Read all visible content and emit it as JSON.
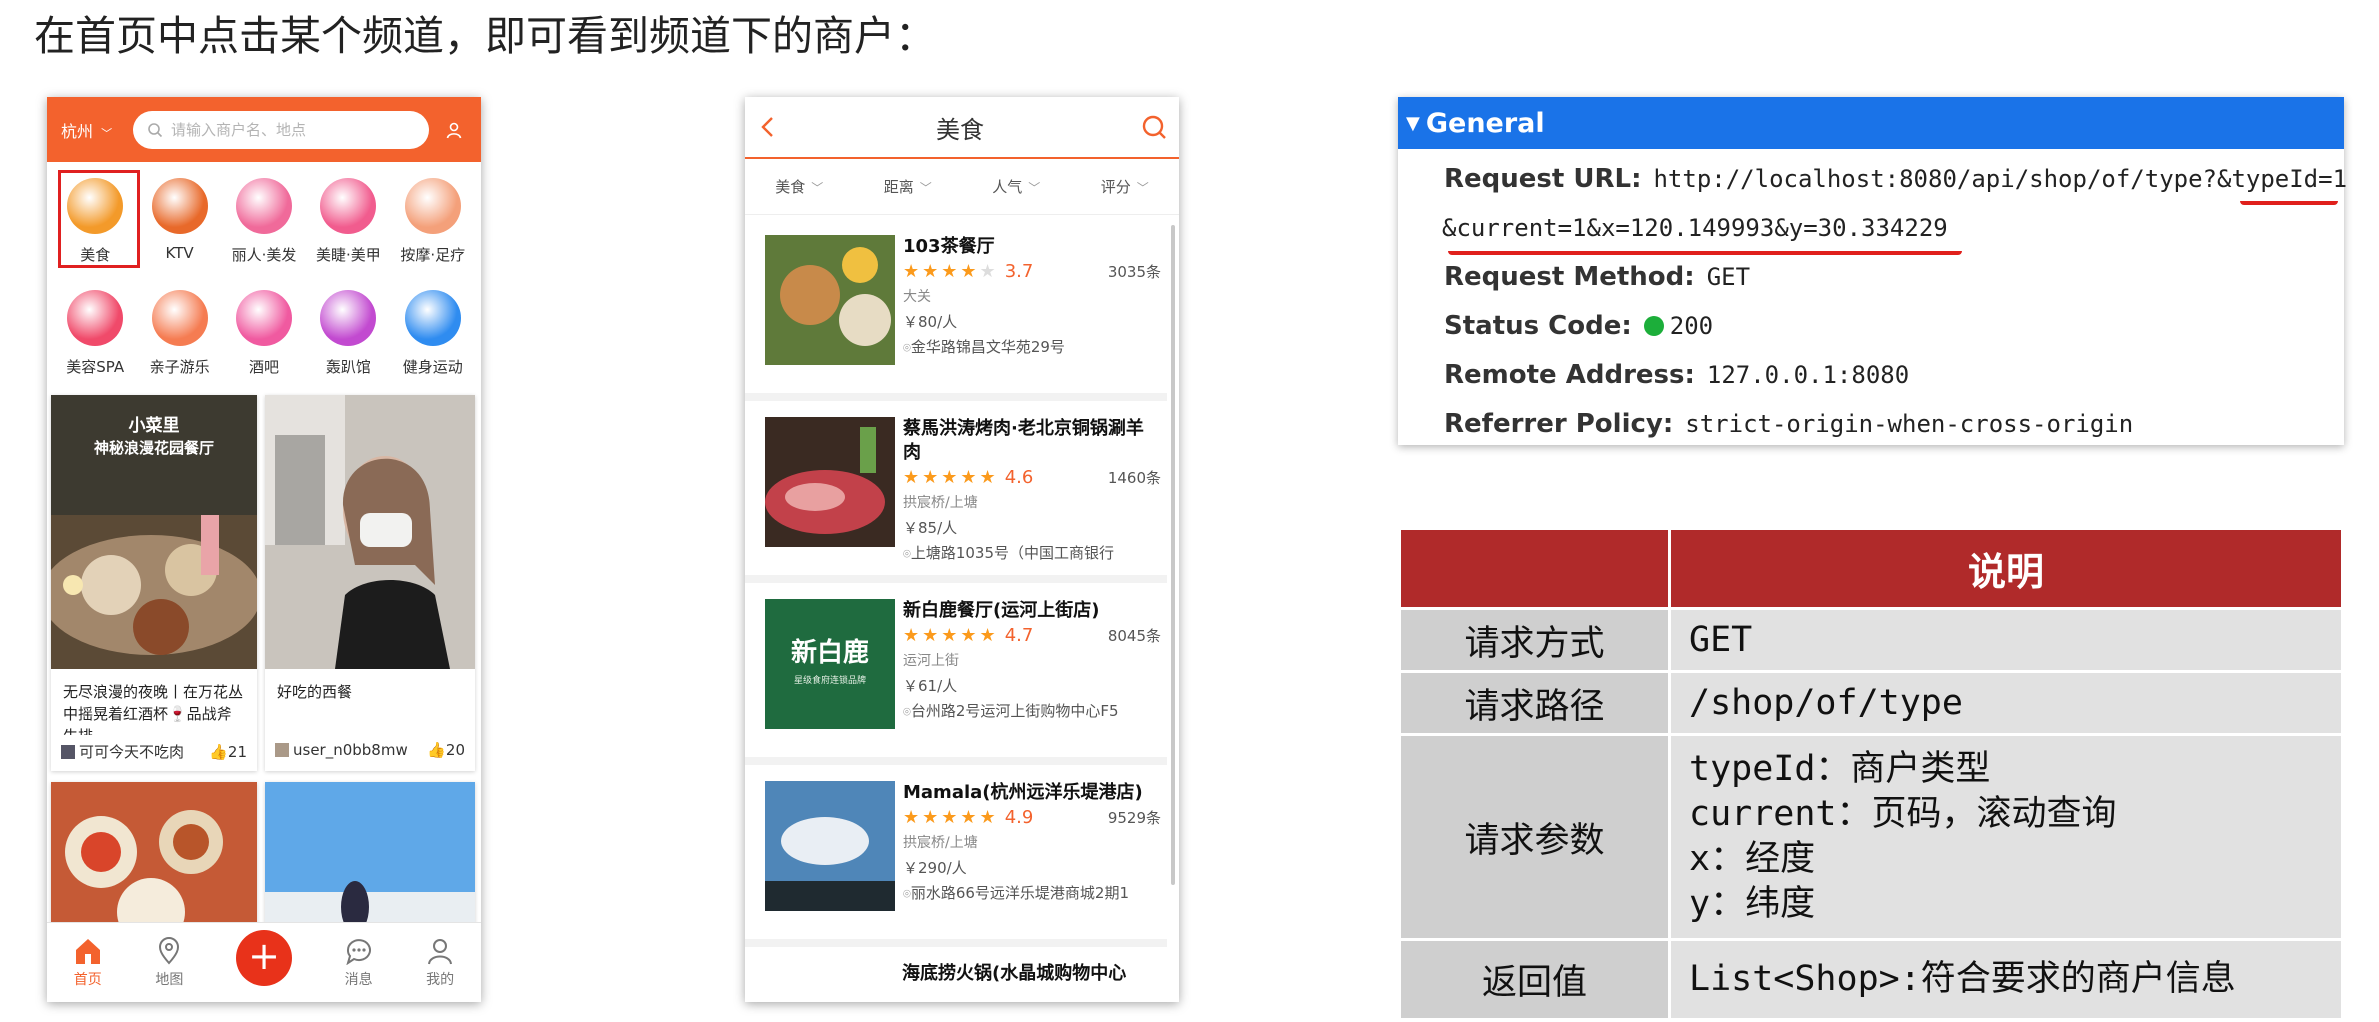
{
  "heading": "在首页中点击某个频道，即可看到频道下的商户：",
  "phone1": {
    "city": "杭州",
    "search_placeholder": "请输入商户名、地点",
    "categories": [
      {
        "label": "美食",
        "icon": "roast-chicken-icon",
        "color": "#f39a2a",
        "selected": true
      },
      {
        "label": "KTV",
        "icon": "microphone-icon",
        "color": "#e8692a",
        "selected": false
      },
      {
        "label": "丽人·美发",
        "icon": "hair-icon",
        "color": "#f06a9a",
        "selected": false
      },
      {
        "label": "美睫·美甲",
        "icon": "nail-icon",
        "color": "#f15c8e",
        "selected": false
      },
      {
        "label": "按摩·足疗",
        "icon": "foot-icon",
        "color": "#f4a07a",
        "selected": false
      },
      {
        "label": "美容SPA",
        "icon": "face-mask-icon",
        "color": "#f04a6a",
        "selected": false
      },
      {
        "label": "亲子游乐",
        "icon": "parent-child-icon",
        "color": "#f57c52",
        "selected": false
      },
      {
        "label": "酒吧",
        "icon": "cocktail-icon",
        "color": "#f05aa0",
        "selected": false
      },
      {
        "label": "轰趴馆",
        "icon": "party-mask-icon",
        "color": "#c24ad0",
        "selected": false
      },
      {
        "label": "健身运动",
        "icon": "dumbbell-icon",
        "color": "#2f8cf0",
        "selected": false
      }
    ],
    "cards": [
      {
        "image_text": "小菜里\n神秘浪漫花园餐厅",
        "desc": "无尽浪漫的夜晚丨在万花丛中摇晃着红酒杯🍷品战斧牛排",
        "user": "可可今天不吃肉",
        "likes": "21"
      },
      {
        "desc": "好吃的西餐",
        "user": "user_n0bb8mw",
        "likes": "20"
      }
    ],
    "tabs": [
      {
        "label": "首页",
        "icon": "home-icon"
      },
      {
        "label": "地图",
        "icon": "map-pin-icon"
      },
      {
        "label": "",
        "icon": "plus-icon"
      },
      {
        "label": "消息",
        "icon": "message-icon"
      },
      {
        "label": "我的",
        "icon": "user-icon"
      }
    ]
  },
  "phone2": {
    "title": "美食",
    "filters": [
      "美食",
      "距离",
      "人气",
      "评分"
    ],
    "shops": [
      {
        "name": "103茶餐厅",
        "stars": "★★★★",
        "half": "★",
        "score": "3.7",
        "count": "3035条",
        "area": "大关",
        "price": "￥80/人",
        "address": "金华路锦昌文华苑29号"
      },
      {
        "name": "蔡馬洪涛烤肉·老北京铜锅涮羊肉",
        "stars": "★★★★★",
        "half": "",
        "score": "4.6",
        "count": "1460条",
        "area": "拱宸桥/上塘",
        "price": "￥85/人",
        "address": "上塘路1035号（中国工商银行"
      },
      {
        "name": "新白鹿餐厅(运河上街店)",
        "stars": "★★★★★",
        "half": "",
        "score": "4.7",
        "count": "8045条",
        "area": "运河上街",
        "price": "￥61/人",
        "address": "台州路2号运河上街购物中心F5"
      },
      {
        "name": "Mamala(杭州远洋乐堤港店)",
        "stars": "★★★★★",
        "half": "",
        "score": "4.9",
        "count": "9529条",
        "area": "拱宸桥/上塘",
        "price": "￥290/人",
        "address": "丽水路66号远洋乐堤港商城2期1"
      }
    ],
    "last_shop": "海底捞火锅(水晶城购物中心",
    "thumb_logo": "新白鹿",
    "thumb_sub": "星级食府连锁品牌"
  },
  "general": {
    "title": "General",
    "request_url_label": "Request URL:",
    "request_url_1": "http://localhost:8080/api/shop/of/type?&typeId=1",
    "request_url_2": "&current=1&x=120.149993&y=30.334229",
    "method_label": "Request Method:",
    "method": "GET",
    "status_label": "Status Code:",
    "status": "200",
    "remote_label": "Remote Address:",
    "remote": "127.0.0.1:8080",
    "referrer_label": "Referrer Policy:",
    "referrer": "strict-origin-when-cross-origin"
  },
  "table": {
    "header": "说明",
    "rows": [
      {
        "key": "请求方式",
        "value": "GET"
      },
      {
        "key": "请求路径",
        "value": "/shop/of/type"
      },
      {
        "key": "请求参数",
        "lines": [
          "typeId：商户类型",
          "current：页码，滚动查询",
          "x：经度",
          "y：纬度"
        ]
      },
      {
        "key": "返回值",
        "value": "List<Shop>:符合要求的商户信息"
      }
    ]
  },
  "colors": {
    "brand_orange": "#f3622d",
    "devtools_blue": "#1a73e8",
    "table_red": "#b02a2a",
    "star": "#fb9a1c"
  }
}
